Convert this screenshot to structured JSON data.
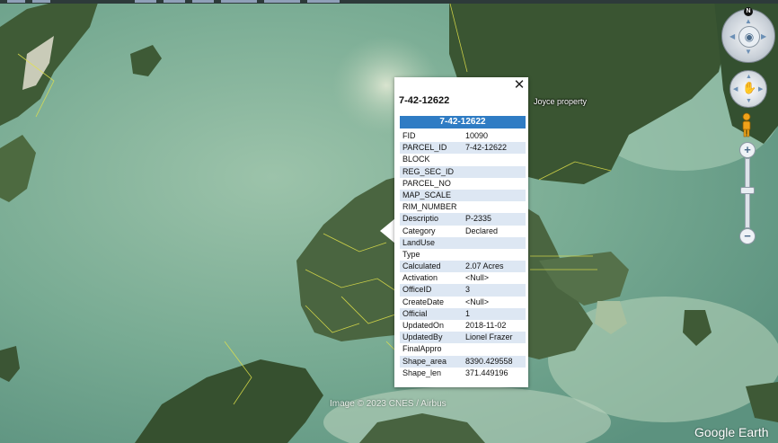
{
  "popup": {
    "title": "7-42-12622",
    "header": "7-42-12622",
    "close_glyph": "✕",
    "rows": [
      {
        "key": "FID",
        "value": "10090"
      },
      {
        "key": "PARCEL_ID",
        "value": "7-42-12622"
      },
      {
        "key": "BLOCK",
        "value": ""
      },
      {
        "key": "REG_SEC_ID",
        "value": ""
      },
      {
        "key": "PARCEL_NO",
        "value": ""
      },
      {
        "key": "MAP_SCALE",
        "value": ""
      },
      {
        "key": "RIM_NUMBER",
        "value": ""
      },
      {
        "key": "Descriptio",
        "value": "P-2335"
      },
      {
        "key": "Category",
        "value": "Declared"
      },
      {
        "key": "LandUse",
        "value": ""
      },
      {
        "key": "Type",
        "value": ""
      },
      {
        "key": "Calculated",
        "value": "2.07 Acres"
      },
      {
        "key": "Activation",
        "value": "<Null>"
      },
      {
        "key": "OfficeID",
        "value": "3"
      },
      {
        "key": "CreateDate",
        "value": "<Null>"
      },
      {
        "key": "Official",
        "value": "1"
      },
      {
        "key": "UpdatedOn",
        "value": "2018-11-02"
      },
      {
        "key": "UpdatedBy",
        "value": "Lionel Frazer"
      },
      {
        "key": "FinalAppro",
        "value": ""
      },
      {
        "key": "Shape_area",
        "value": "8390.429558"
      },
      {
        "key": "Shape_len",
        "value": "371.449196"
      }
    ]
  },
  "map": {
    "place_label": "Joyce property",
    "imagery_credit": "Image © 2023 CNES / Airbus",
    "brand": "Google Earth",
    "header_color": "#2f7cc4",
    "parcel_line_color": "#e3e34a"
  },
  "controls": {
    "compass_north": "N",
    "zoom_in": "+",
    "zoom_out": "−",
    "compass_icon": "eye-icon",
    "pan_icon": "hand-icon",
    "street_view_icon": "pegman-icon"
  }
}
